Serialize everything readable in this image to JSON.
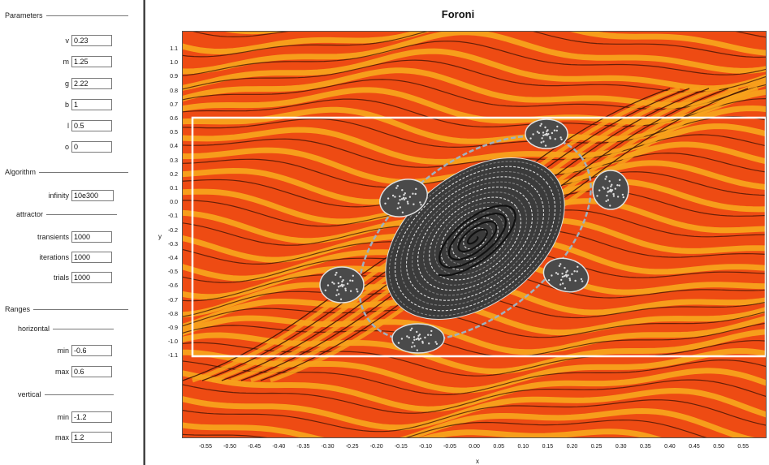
{
  "panel": {
    "parameters": {
      "header": "Parameters",
      "fields": [
        {
          "label": "v",
          "value": "0.23"
        },
        {
          "label": "m",
          "value": "1.25"
        },
        {
          "label": "g",
          "value": "2.22"
        },
        {
          "label": "b",
          "value": "1"
        },
        {
          "label": "l",
          "value": "0.5"
        },
        {
          "label": "o",
          "value": "0"
        }
      ]
    },
    "algorithm": {
      "header": "Algorithm",
      "infinity": {
        "label": "infinity",
        "value": "10e300"
      },
      "attractor_header": "attractor",
      "transients": {
        "label": "transients",
        "value": "1000"
      },
      "iterations": {
        "label": "iterations",
        "value": "1000"
      },
      "trials": {
        "label": "trials",
        "value": "1000"
      }
    },
    "ranges": {
      "header": "Ranges",
      "horizontal_header": "horizontal",
      "h_min": {
        "label": "min",
        "value": "-0.6"
      },
      "h_max": {
        "label": "max",
        "value": "0.6"
      },
      "vertical_header": "vertical",
      "v_min": {
        "label": "min",
        "value": "-1.2"
      },
      "v_max": {
        "label": "max",
        "value": "1.2"
      }
    }
  },
  "plot": {
    "title": "Foroni",
    "xlabel": "x",
    "ylabel": "y",
    "x_ticks": [
      "-0.55",
      "-0.50",
      "-0.45",
      "-0.40",
      "-0.35",
      "-0.30",
      "-0.25",
      "-0.20",
      "-0.15",
      "-0.10",
      "-0.05",
      "0.00",
      "0.05",
      "0.10",
      "0.15",
      "0.20",
      "0.25",
      "0.30",
      "0.35",
      "0.40",
      "0.45",
      "0.50",
      "0.55"
    ],
    "y_ticks": [
      "1.1",
      "1.0",
      "0.9",
      "0.8",
      "0.7",
      "0.6",
      "0.5",
      "0.4",
      "0.3",
      "0.2",
      "0.1",
      "0.0",
      "-0.1",
      "-0.2",
      "-0.3",
      "-0.4",
      "-0.5",
      "-0.6",
      "-0.7",
      "-0.8",
      "-0.9",
      "-1.0",
      "-1.1"
    ],
    "colors": {
      "background": "#ee4b13",
      "band": "#f7a21b",
      "stripe": "#3a1205",
      "frame": "#ffffff",
      "attractor": "#1a1a1a"
    }
  }
}
